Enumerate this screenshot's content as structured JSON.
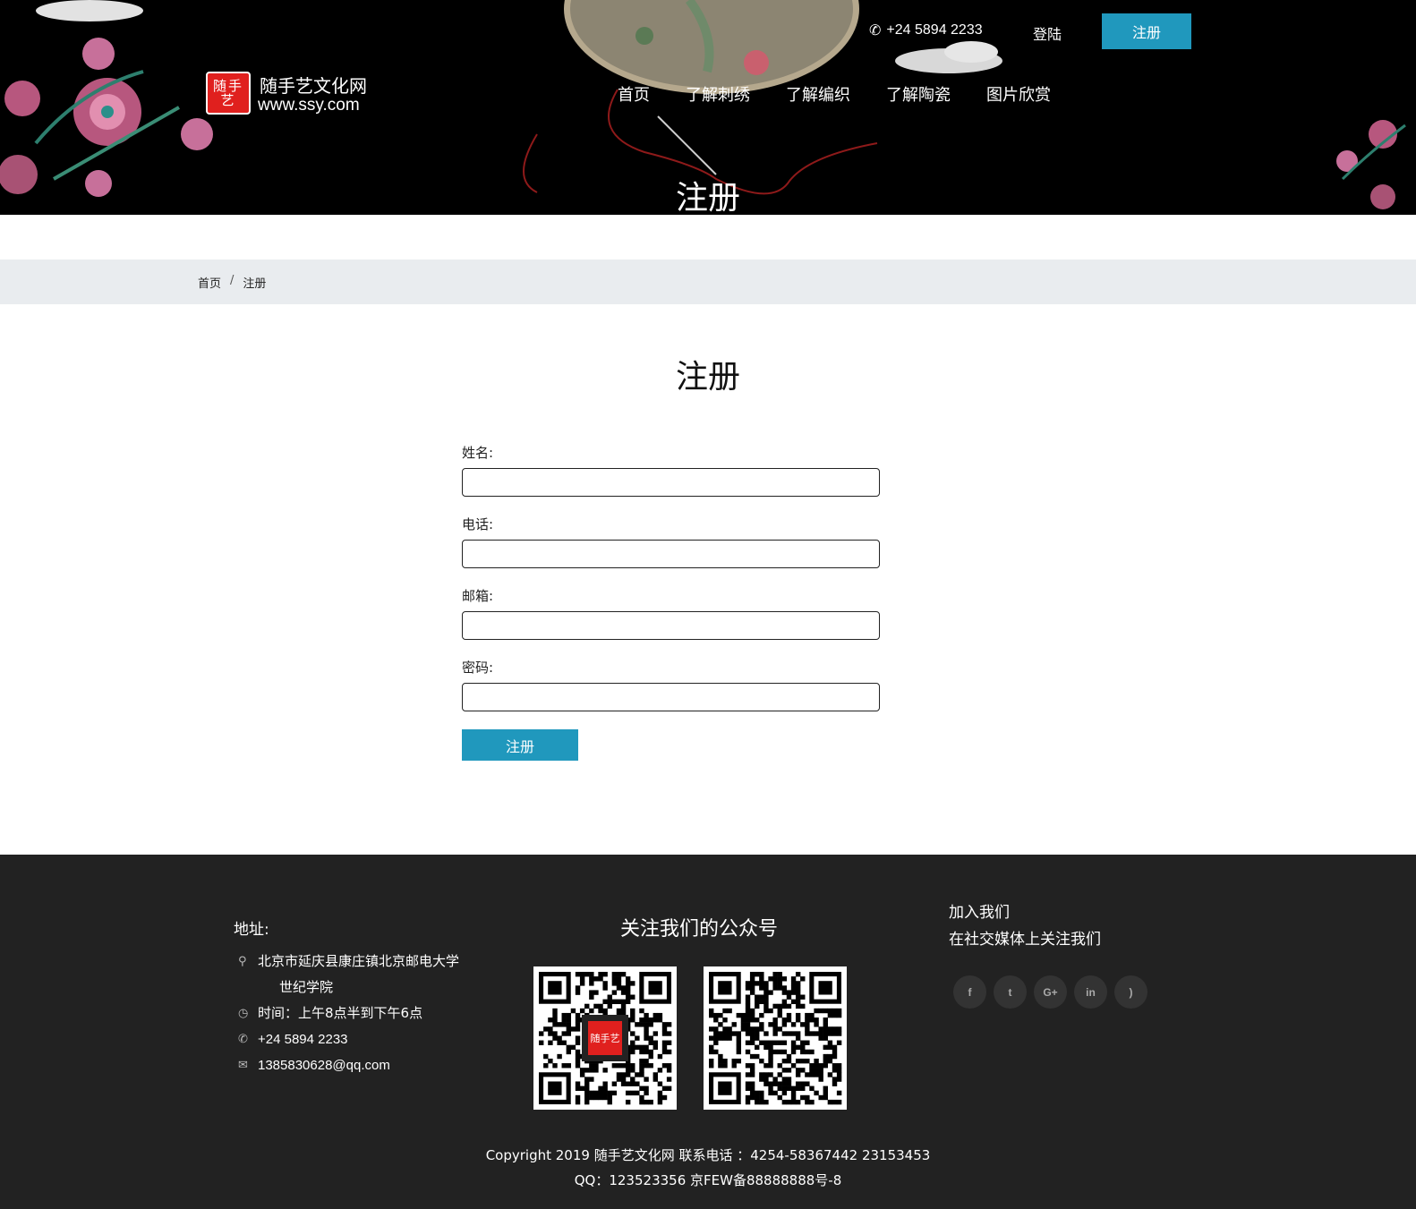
{
  "header": {
    "logo_seal": "随手艺",
    "logo_name": "随手艺文化网",
    "logo_url": "www.ssy.com",
    "phone": "+24 5894 2233",
    "login": "登陆",
    "register": "注册",
    "nav": [
      "首页",
      "了解刺绣",
      "了解编织",
      "了解陶瓷",
      "图片欣赏"
    ],
    "banner_title": "注册"
  },
  "breadcrumb": {
    "home": "首页",
    "separator": "/",
    "current": "注册"
  },
  "form": {
    "heading": "注册",
    "fields": [
      {
        "label": "姓名:",
        "value": ""
      },
      {
        "label": "电话:",
        "value": ""
      },
      {
        "label": "邮箱:",
        "value": ""
      },
      {
        "label": "密码:",
        "value": ""
      }
    ],
    "submit": "注册"
  },
  "footer": {
    "address_title": "地址:",
    "address_line1": "北京市延庆县康庄镇北京邮电大学",
    "address_line2": "世纪学院",
    "hours": "时间：上午8点半到下午6点",
    "phone": "+24 5894 2233",
    "email": "1385830628@qq.com",
    "qr_title": "关注我们的公众号",
    "join_line1": "加入我们",
    "join_line2": "在社交媒体上关注我们",
    "social": [
      {
        "icon": "facebook-icon",
        "glyph": "f"
      },
      {
        "icon": "twitter-icon",
        "glyph": "t"
      },
      {
        "icon": "google-plus-icon",
        "glyph": "G+"
      },
      {
        "icon": "linkedin-icon",
        "glyph": "in"
      },
      {
        "icon": "rss-icon",
        "glyph": ")"
      }
    ],
    "copyright_line1": "Copyright 2019 随手艺文化网  联系电话 ：4254-58367442 23153453",
    "copyright_line2": "QQ：123523356  京FEW备88888888号-8"
  },
  "colors": {
    "accent": "#2098bd",
    "footer_bg": "#222222",
    "breadcrumb_bg": "#e9ecef",
    "seal_red": "#e0201e"
  }
}
